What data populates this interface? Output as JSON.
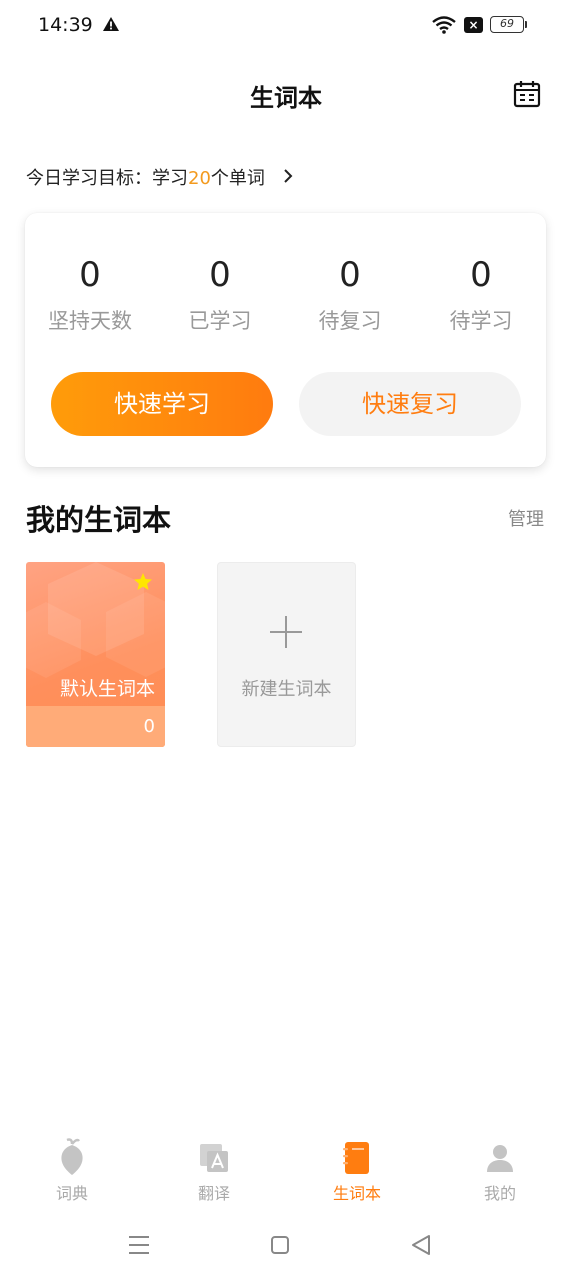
{
  "status": {
    "time": "14:39",
    "battery": "69"
  },
  "header": {
    "title": "生词本"
  },
  "goal": {
    "prefix": "今日学习目标：学习",
    "count": "20",
    "suffix": "个单词"
  },
  "stats": [
    {
      "value": "0",
      "label": "坚持天数"
    },
    {
      "value": "0",
      "label": "已学习"
    },
    {
      "value": "0",
      "label": "待复习"
    },
    {
      "value": "0",
      "label": "待学习"
    }
  ],
  "actions": {
    "learn_label": "快速学习",
    "review_label": "快速复习"
  },
  "notebooks": {
    "section_title": "我的生词本",
    "manage_label": "管理",
    "items": [
      {
        "name": "默认生词本",
        "count": "0"
      }
    ],
    "new_label": "新建生词本"
  },
  "tabs": [
    {
      "label": "词典",
      "icon": "dictionary-icon"
    },
    {
      "label": "翻译",
      "icon": "translate-icon"
    },
    {
      "label": "生词本",
      "icon": "notebook-icon"
    },
    {
      "label": "我的",
      "icon": "profile-icon"
    }
  ],
  "colors": {
    "accent": "#ff7d10",
    "goal_number": "#f39a1e"
  }
}
